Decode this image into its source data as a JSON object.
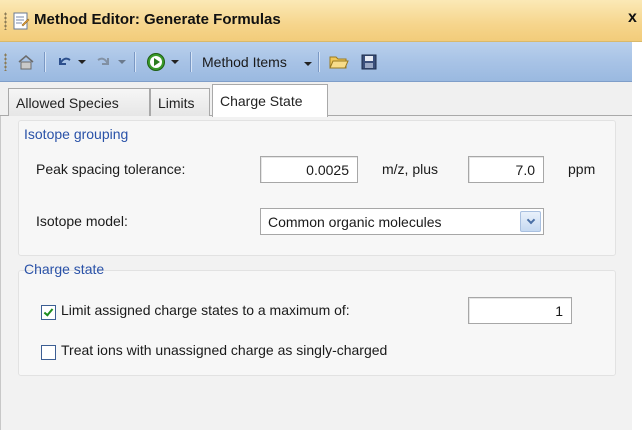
{
  "window": {
    "title": "Method Editor: Generate Formulas",
    "close_glyph": "x"
  },
  "toolbar": {
    "home_icon": "home-icon",
    "undo_icon": "undo-icon",
    "redo_icon": "redo-icon",
    "run_icon": "run-icon",
    "method_items_label": "Method Items",
    "open_icon": "open-folder-icon",
    "save_icon": "save-icon"
  },
  "tabs": [
    {
      "label": "Allowed Species",
      "active": false
    },
    {
      "label": "Limits",
      "active": false
    },
    {
      "label": "Charge State",
      "active": true
    }
  ],
  "isotope_grouping": {
    "title": "Isotope grouping",
    "peak_spacing_label": "Peak spacing tolerance:",
    "peak_spacing_value": "0.0025",
    "mz_plus_label": "m/z, plus",
    "ppm_value": "7.0",
    "ppm_label": "ppm",
    "isotope_model_label": "Isotope model:",
    "isotope_model_value": "Common organic molecules"
  },
  "charge_state": {
    "title": "Charge state",
    "limit_label": "Limit assigned charge states to a maximum of:",
    "limit_checked": true,
    "limit_value": "1",
    "treat_label": "Treat ions with unassigned charge as singly-charged",
    "treat_checked": false
  },
  "colors": {
    "title_bar": "#f6d58c",
    "toolbar": "#a8c3e6",
    "group_title": "#2a52a8",
    "check": "#1d8c1d"
  }
}
